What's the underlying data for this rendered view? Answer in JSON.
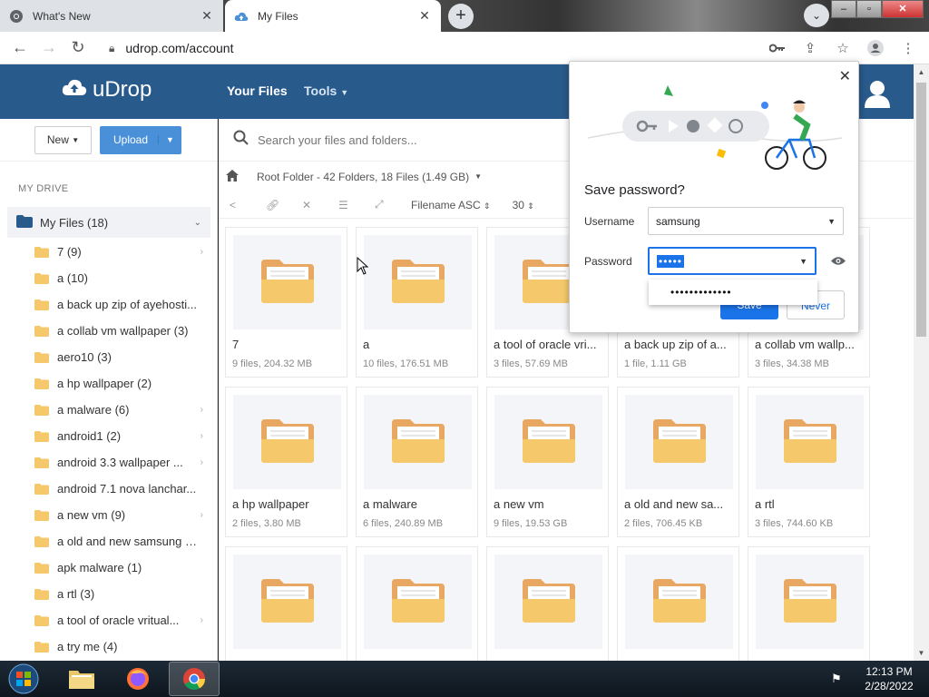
{
  "browser": {
    "tabs": [
      {
        "label": "What's New",
        "active": false
      },
      {
        "label": "My Files",
        "active": true
      }
    ],
    "url": "udrop.com/account"
  },
  "header": {
    "logo": "uDrop",
    "nav": {
      "your_files": "Your Files",
      "tools": "Tools"
    }
  },
  "sidebar": {
    "new_label": "New",
    "upload_label": "Upload",
    "section_label": "MY DRIVE",
    "root_label": "My Files (18)",
    "folders": [
      {
        "name": "7 (9)",
        "has_children": true
      },
      {
        "name": "a (10)",
        "has_children": false
      },
      {
        "name": "a back up zip of ayehosti...",
        "has_children": false
      },
      {
        "name": "a collab vm wallpaper (3)",
        "has_children": false
      },
      {
        "name": "aero10 (3)",
        "has_children": false
      },
      {
        "name": "a hp wallpaper (2)",
        "has_children": false
      },
      {
        "name": "a malware (6)",
        "has_children": true
      },
      {
        "name": "android1 (2)",
        "has_children": true
      },
      {
        "name": "android 3.3 wallpaper ...",
        "has_children": true
      },
      {
        "name": "android 7.1 nova lanchar...",
        "has_children": false
      },
      {
        "name": "a new vm (9)",
        "has_children": true
      },
      {
        "name": "a old and new samsung d...",
        "has_children": false
      },
      {
        "name": "apk malware (1)",
        "has_children": false
      },
      {
        "name": "a rtl (3)",
        "has_children": false
      },
      {
        "name": "a tool of oracle vritual...",
        "has_children": true
      },
      {
        "name": "a try me (4)",
        "has_children": false
      }
    ]
  },
  "main": {
    "search_placeholder": "Search your files and folders...",
    "breadcrumb": "Root Folder - 42 Folders, 18 Files (1.49 GB)",
    "sort_label": "Filename ASC",
    "per_page": "30",
    "cards": [
      {
        "name": "7",
        "meta": "9 files, 204.32 MB"
      },
      {
        "name": "a",
        "meta": "10 files, 176.51 MB"
      },
      {
        "name": "a tool of oracle vri...",
        "meta": "3 files, 57.69 MB"
      },
      {
        "name": "a back up zip of a...",
        "meta": "1 file, 1.11 GB"
      },
      {
        "name": "a collab vm wallp...",
        "meta": "3 files, 34.38 MB"
      },
      {
        "name": "a hp wallpaper",
        "meta": "2 files, 3.80 MB"
      },
      {
        "name": "a malware",
        "meta": "6 files, 240.89 MB"
      },
      {
        "name": "a new vm",
        "meta": "9 files, 19.53 GB"
      },
      {
        "name": "a old and new sa...",
        "meta": "2 files, 706.45 KB"
      },
      {
        "name": "a rtl",
        "meta": "3 files, 744.60 KB"
      },
      {
        "name": "",
        "meta": ""
      },
      {
        "name": "",
        "meta": ""
      },
      {
        "name": "",
        "meta": ""
      },
      {
        "name": "",
        "meta": ""
      },
      {
        "name": "",
        "meta": ""
      }
    ]
  },
  "password_popup": {
    "title": "Save password?",
    "username_label": "Username",
    "username_value": "samsung",
    "password_label": "Password",
    "password_value": "•••••",
    "suggestion": "•••••••••••••",
    "save_label": "Save",
    "never_label": "Never"
  },
  "taskbar": {
    "time": "12:13 PM",
    "date": "2/28/2022"
  },
  "colors": {
    "header_bg": "#295a8c",
    "upload_btn": "#4a90d9",
    "chrome_blue": "#1a73e8",
    "folder_yellow": "#f5c96b"
  }
}
